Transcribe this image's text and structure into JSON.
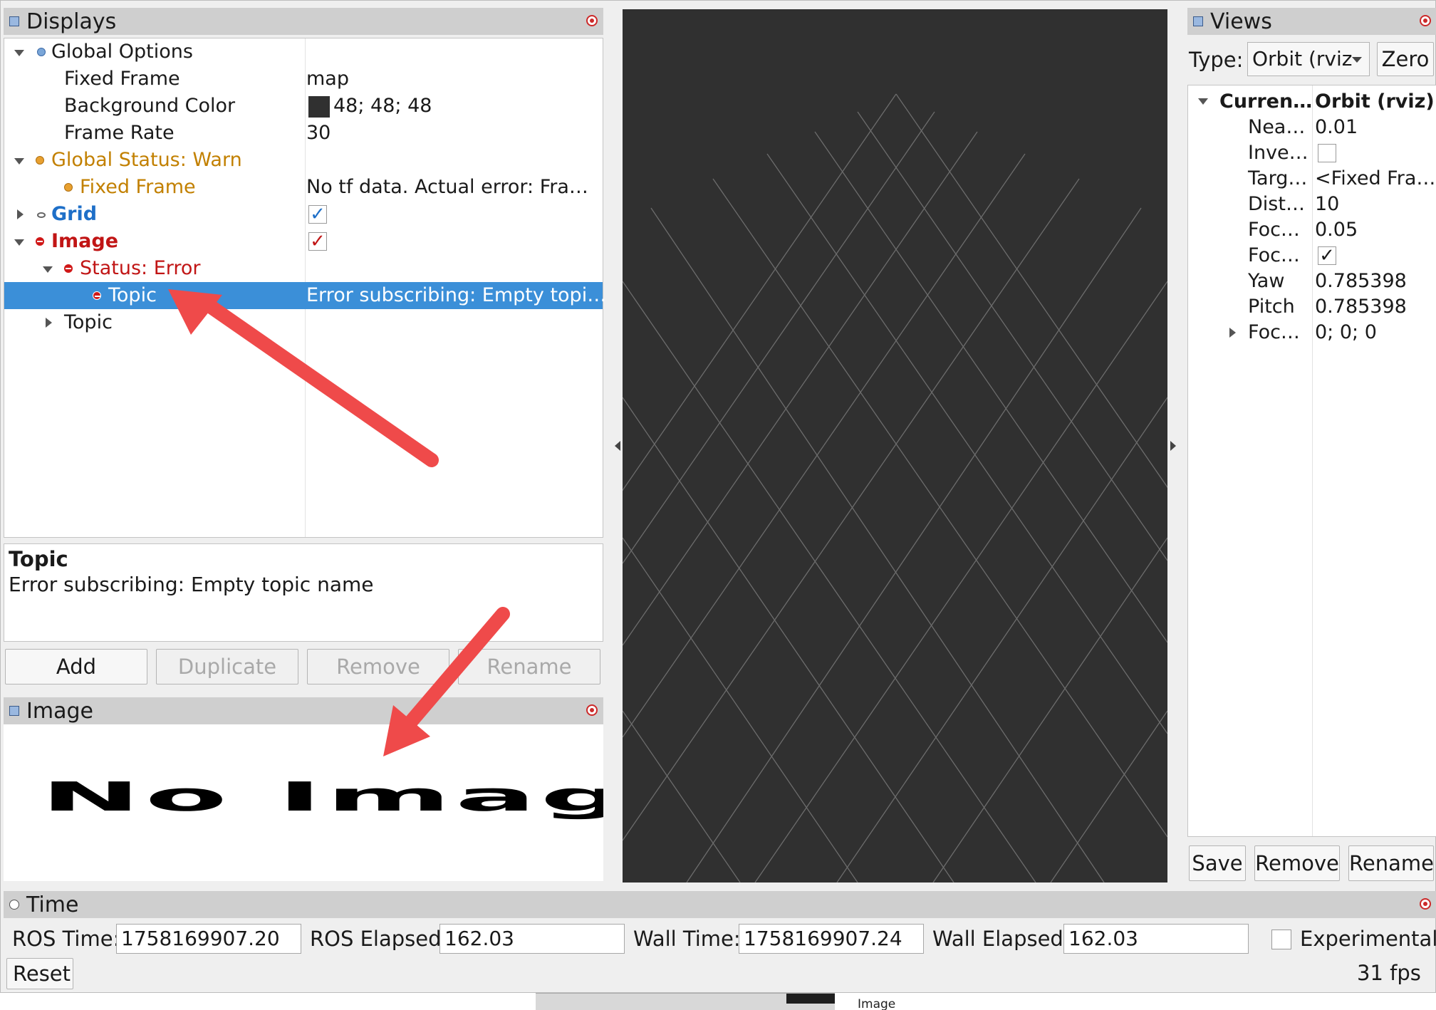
{
  "displays": {
    "title": "Displays",
    "tree": {
      "global_options": "Global Options",
      "fixed_frame_label": "Fixed Frame",
      "fixed_frame_value": "map",
      "bg_color_label": "Background Color",
      "bg_color_value": "48; 48; 48",
      "frame_rate_label": "Frame Rate",
      "frame_rate_value": "30",
      "global_status": "Global Status: Warn",
      "status_fixed_frame_label": "Fixed Frame",
      "status_fixed_frame_value": "No tf data.  Actual error: Fra…",
      "grid_label": "Grid",
      "image_label": "Image",
      "status_error": "Status: Error",
      "topic_err_label": "Topic",
      "topic_err_value": "Error subscribing: Empty topi…",
      "topic_label": "Topic",
      "check_mark": "✓"
    },
    "desc_title": "Topic",
    "desc_text": "Error subscribing: Empty topic name",
    "buttons": {
      "add": "Add",
      "duplicate": "Duplicate",
      "remove": "Remove",
      "rename": "Rename"
    }
  },
  "image_panel": {
    "title": "Image",
    "placeholder": "No Image"
  },
  "views": {
    "title": "Views",
    "type_label": "Type:",
    "type_value": "Orbit (rviz",
    "zero": "Zero",
    "props": [
      {
        "name": "Curren…",
        "value": "Orbit (rviz)"
      },
      {
        "name": "Nea…",
        "value": "0.01"
      },
      {
        "name": "Inve…",
        "value": ""
      },
      {
        "name": "Targ…",
        "value": "<Fixed Fra…"
      },
      {
        "name": "Dist…",
        "value": "10"
      },
      {
        "name": "Foc…",
        "value": "0.05"
      },
      {
        "name": "Foc…",
        "value": "✓"
      },
      {
        "name": "Yaw",
        "value": "0.785398"
      },
      {
        "name": "Pitch",
        "value": "0.785398"
      },
      {
        "name": "Foc…",
        "value": "0; 0; 0"
      }
    ],
    "buttons": {
      "save": "Save",
      "remove": "Remove",
      "rename": "Rename"
    }
  },
  "time": {
    "title": "Time",
    "ros_time_label": "ROS Time:",
    "ros_time": "1758169907.20",
    "ros_elapsed_label": "ROS Elapsed:",
    "ros_elapsed": "162.03",
    "wall_time_label": "Wall Time:",
    "wall_time": "1758169907.24",
    "wall_elapsed_label": "Wall Elapsed:",
    "wall_elapsed": "162.03",
    "experimental": "Experimental",
    "reset": "Reset",
    "fps": "31 fps"
  },
  "taskbar": {
    "text": "Image"
  },
  "colors": {
    "viewport_bg": "#303030",
    "selection": "#3b8fd8",
    "warn": "#c28000",
    "error": "#c11515",
    "grid_blue": "#1e6fc8"
  }
}
